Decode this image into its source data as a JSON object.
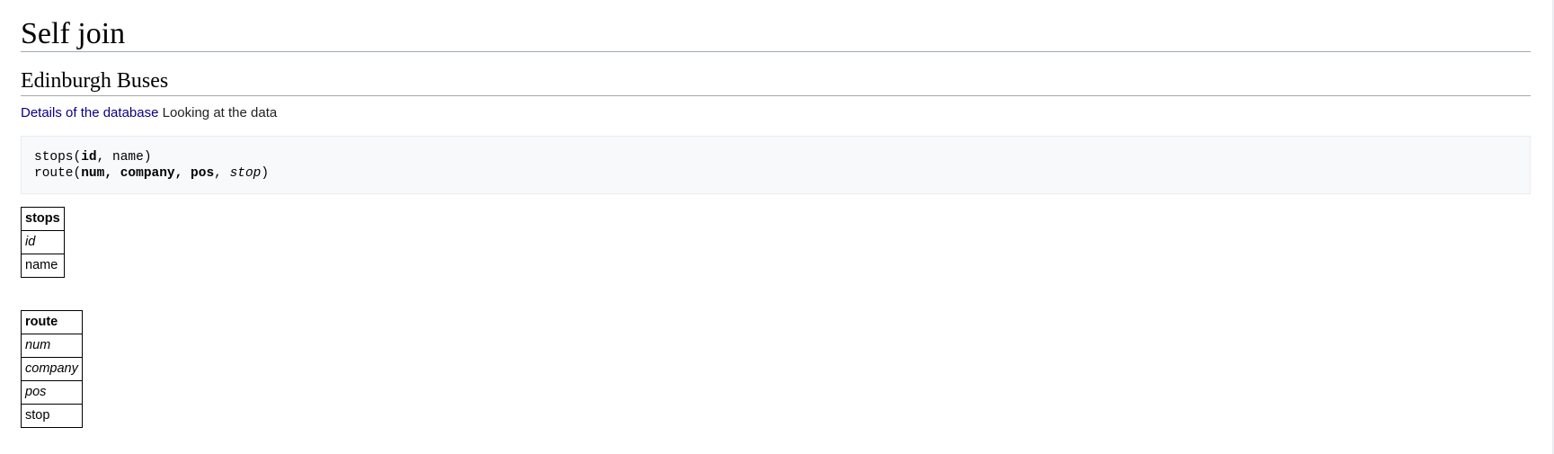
{
  "page": {
    "title": "Self join",
    "section_title": "Edinburgh Buses",
    "intro": {
      "link_text": "Details of the database",
      "trailing_text": " Looking at the data"
    }
  },
  "schema_block": {
    "stops_line": {
      "name": "stops",
      "key_field": "id",
      "other_fields": ", name)"
    },
    "route_line": {
      "name": "route",
      "key_fields": "num, company, pos",
      "foreign_field": "stop"
    }
  },
  "tables": {
    "stops": {
      "header": "stops",
      "rows": [
        {
          "label": "id",
          "key": true
        },
        {
          "label": "name",
          "key": false
        }
      ]
    },
    "route": {
      "header": "route",
      "rows": [
        {
          "label": "num",
          "key": true
        },
        {
          "label": "company",
          "key": true
        },
        {
          "label": "pos",
          "key": true
        },
        {
          "label": "stop",
          "key": false
        }
      ]
    }
  }
}
